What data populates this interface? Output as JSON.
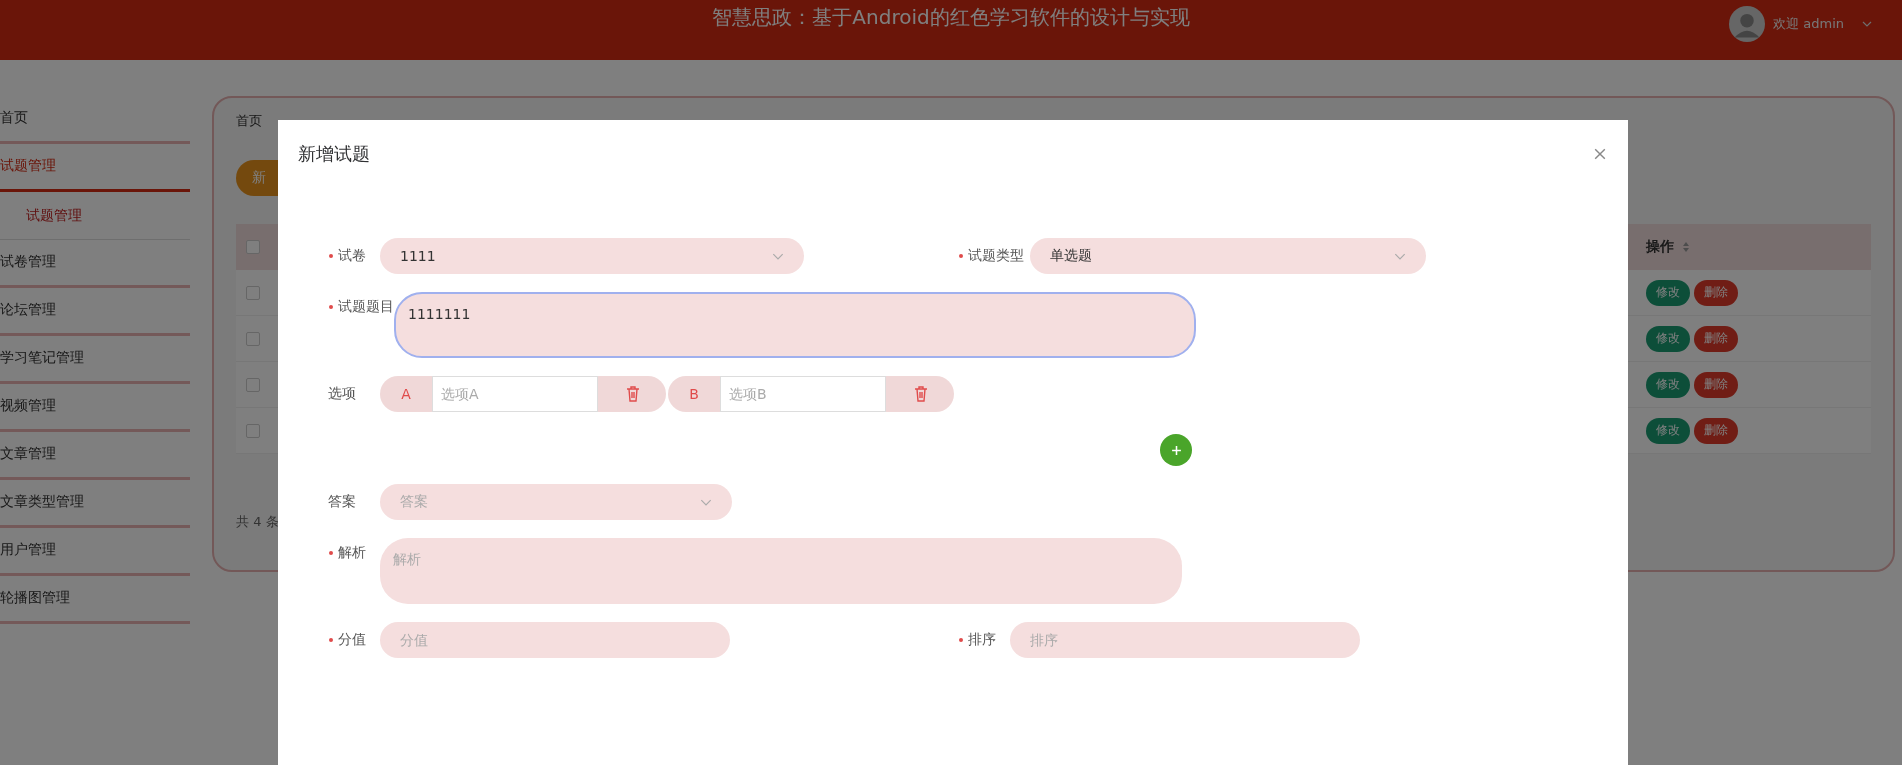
{
  "header": {
    "title": "智慧思政：基于Android的红色学习软件的设计与实现",
    "user": "欢迎 admin"
  },
  "sidebar": {
    "items": [
      {
        "label": "首页",
        "selected": false
      },
      {
        "label": "试题管理",
        "selected": true,
        "expanded": true,
        "children": [
          {
            "label": "试题管理",
            "selected": true
          }
        ]
      },
      {
        "label": "试卷管理",
        "selected": false
      },
      {
        "label": "论坛管理",
        "selected": false
      },
      {
        "label": "学习笔记管理",
        "selected": false
      },
      {
        "label": "视频管理",
        "selected": false
      },
      {
        "label": "文章管理",
        "selected": false
      },
      {
        "label": "文章类型管理",
        "selected": false
      },
      {
        "label": "用户管理",
        "selected": false
      },
      {
        "label": "轮播图管理",
        "selected": false
      }
    ]
  },
  "tabs": [
    {
      "label": "首页",
      "selected": false
    }
  ],
  "add_button": "新",
  "table": {
    "columns": [
      {
        "kind": "checkbox",
        "checked": false
      },
      {
        "kind": "text",
        "label": "操作"
      }
    ],
    "rows": [
      {
        "checked": false,
        "actions": [
          "修改",
          "删除"
        ]
      },
      {
        "checked": false,
        "actions": [
          "修改",
          "删除"
        ]
      },
      {
        "checked": false,
        "actions": [
          "修改",
          "删除"
        ]
      },
      {
        "checked": false,
        "actions": [
          "修改",
          "删除"
        ]
      }
    ],
    "total": "共 4 条"
  },
  "dialog": {
    "title": "新增试题",
    "paper": {
      "label": "试卷",
      "required": true,
      "value": "1111"
    },
    "type": {
      "label": "试题类型",
      "required": true,
      "value": "单选题"
    },
    "question": {
      "label": "试题题目",
      "required": true,
      "value": "1111111",
      "focused": true
    },
    "options": {
      "label": "选项",
      "items": [
        {
          "letter": "A",
          "placeholder": "选项A"
        },
        {
          "letter": "B",
          "placeholder": "选项B"
        }
      ]
    },
    "answer": {
      "label": "答案",
      "required": false,
      "placeholder": "答案"
    },
    "analysis": {
      "label": "解析",
      "required": true,
      "placeholder": "解析"
    },
    "score": {
      "label": "分值",
      "required": true,
      "placeholder": "分值"
    },
    "order": {
      "label": "排序",
      "required": true,
      "placeholder": "排序"
    }
  }
}
